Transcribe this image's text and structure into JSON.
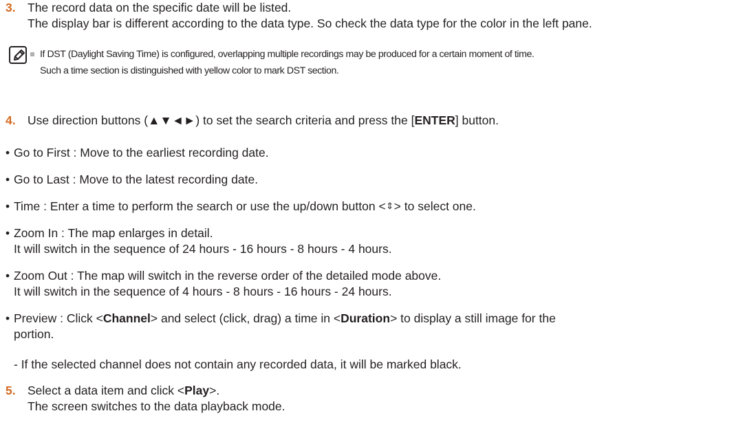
{
  "step3": {
    "number": "3.",
    "line1": "The record data on the specific date will be listed.",
    "line2": "The display bar is different according to the data type. So check the data type for the color in the left pane."
  },
  "note": {
    "icon": "note-pencil-icon",
    "line1": "If DST (Daylight Saving Time) is configured, overlapping multiple recordings may be produced for a certain moment of time.",
    "line2": "Such a time section is distinguished with yellow color to mark DST section."
  },
  "step4": {
    "number": "4.",
    "text_before": "Use direction buttons (▲▼◄►) to set the search criteria and press the [",
    "key": "ENTER",
    "text_after": "] button."
  },
  "bullets": {
    "go_first": "Go to First : Move to the earliest recording date.",
    "go_last": "Go to Last : Move to the latest recording date.",
    "time_before": "Time : Enter a time to perform the search or use the up/down button <",
    "time_symbol": "⇕",
    "time_after": "> to select one.",
    "zoom_in_line1": "Zoom In : The map enlarges in detail.",
    "zoom_in_line2": "It will switch in the sequence of 24 hours - 16 hours - 8 hours - 4 hours.",
    "zoom_out_line1": "Zoom Out : The map will switch in the reverse order of the detailed mode above.",
    "zoom_out_line2": "It will switch in the sequence of 4 hours - 8 hours - 16 hours - 24 hours.",
    "preview_p1": "Preview : Click <",
    "preview_channel": "Channel",
    "preview_p2": "> and select (click, drag) a time in <",
    "preview_duration": "Duration",
    "preview_p3": "> to display a still image for the",
    "preview_line2": "portion.",
    "preview_sub": "- If the selected channel does not contain any recorded data, it will be marked black."
  },
  "step5": {
    "number": "5.",
    "text_before": "Select a data item and click <",
    "key": "Play",
    "text_after": ">.",
    "line2": "The screen switches to the data playback mode."
  },
  "bullet_symbol": "•",
  "note_bullet_color": "#b0b0b0",
  "step_number_color": "#d3691f"
}
